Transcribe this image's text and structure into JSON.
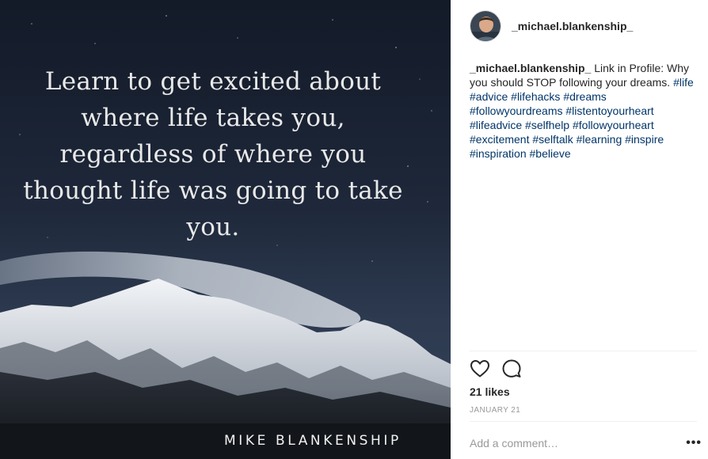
{
  "post": {
    "quote_lines": [
      "Learn to get excited about",
      "where life takes you,",
      "regardless of where you",
      "thought life was going to take",
      "you."
    ],
    "signature": "MIKE BLANKENSHIP"
  },
  "header": {
    "username": "_michael.blankenship_",
    "avatar_icon": "user-avatar-icon"
  },
  "caption": {
    "username": "_michael.blankenship_",
    "text": "Link in Profile: Why you should STOP following your dreams.",
    "hashtags": [
      "#life",
      "#advice",
      "#lifehacks",
      "#dreams",
      "#followyourdreams",
      "#listentoyourheart",
      "#lifeadvice",
      "#selfhelp",
      "#followyourheart",
      "#excitement",
      "#selftalk",
      "#learning",
      "#inspire",
      "#inspiration",
      "#believe"
    ]
  },
  "actions": {
    "like_icon": "heart-icon",
    "comment_icon": "comment-icon"
  },
  "likes": "21 likes",
  "date": "JANUARY 21",
  "comment": {
    "placeholder": "Add a comment…",
    "more_label": "•••"
  },
  "colors": {
    "hashtag": "#003569",
    "secondary_text": "#999999",
    "primary_text": "#262626"
  }
}
